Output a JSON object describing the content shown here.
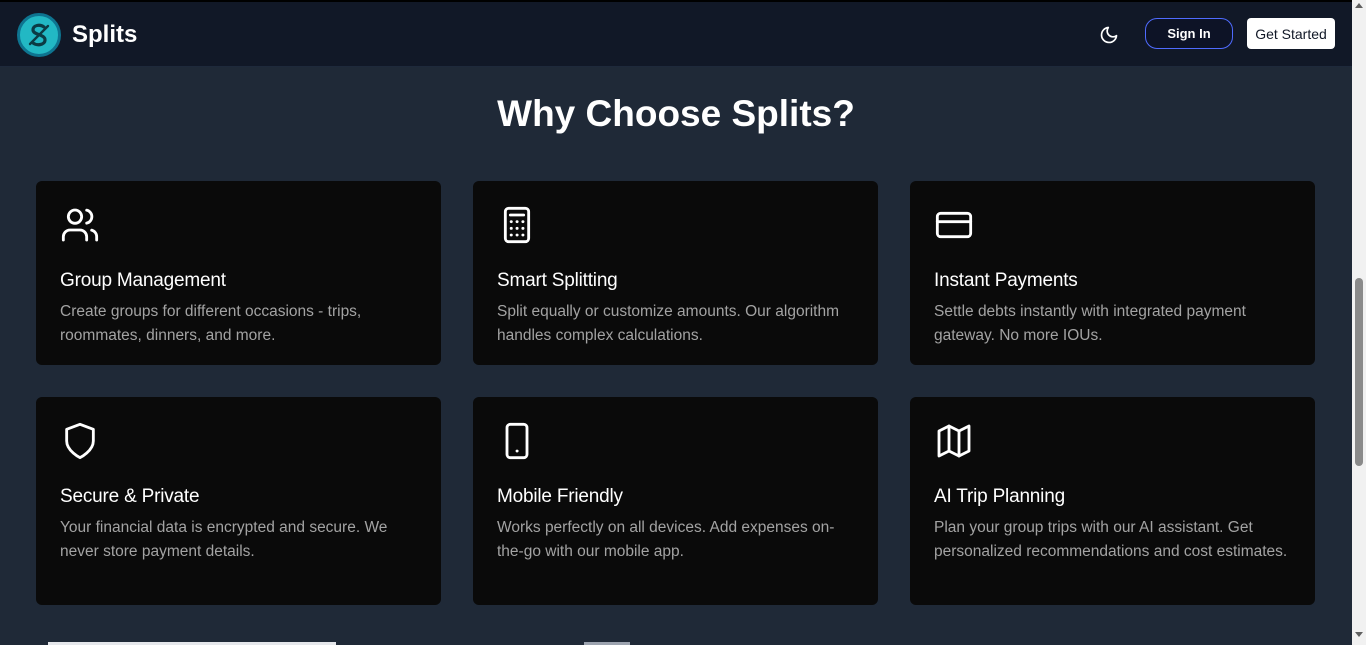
{
  "header": {
    "brand": "Splits",
    "theme_toggle_icon": "moon-icon",
    "sign_in_label": "Sign In",
    "get_started_label": "Get Started"
  },
  "section": {
    "title": "Why Choose Splits?"
  },
  "features": [
    {
      "icon": "users-icon",
      "title": "Group Management",
      "description": "Create groups for different occasions - trips, roommates, dinners, and more."
    },
    {
      "icon": "calculator-icon",
      "title": "Smart Splitting",
      "description": "Split equally or customize amounts. Our algorithm handles complex calculations."
    },
    {
      "icon": "credit-card-icon",
      "title": "Instant Payments",
      "description": "Settle debts instantly with integrated payment gateway. No more IOUs."
    },
    {
      "icon": "shield-icon",
      "title": "Secure & Private",
      "description": "Your financial data is encrypted and secure. We never store payment details."
    },
    {
      "icon": "smartphone-icon",
      "title": "Mobile Friendly",
      "description": "Works perfectly on all devices. Add expenses on-the-go with our mobile app."
    },
    {
      "icon": "map-icon",
      "title": "AI Trip Planning",
      "description": "Plan your group trips with our AI assistant. Get personalized recommendations and cost estimates."
    }
  ],
  "colors": {
    "page_bg": "#1f2937",
    "header_bg": "#111827",
    "card_bg": "#0a0a0a",
    "accent_border": "#4f6bff",
    "logo": "#22b8c4"
  }
}
